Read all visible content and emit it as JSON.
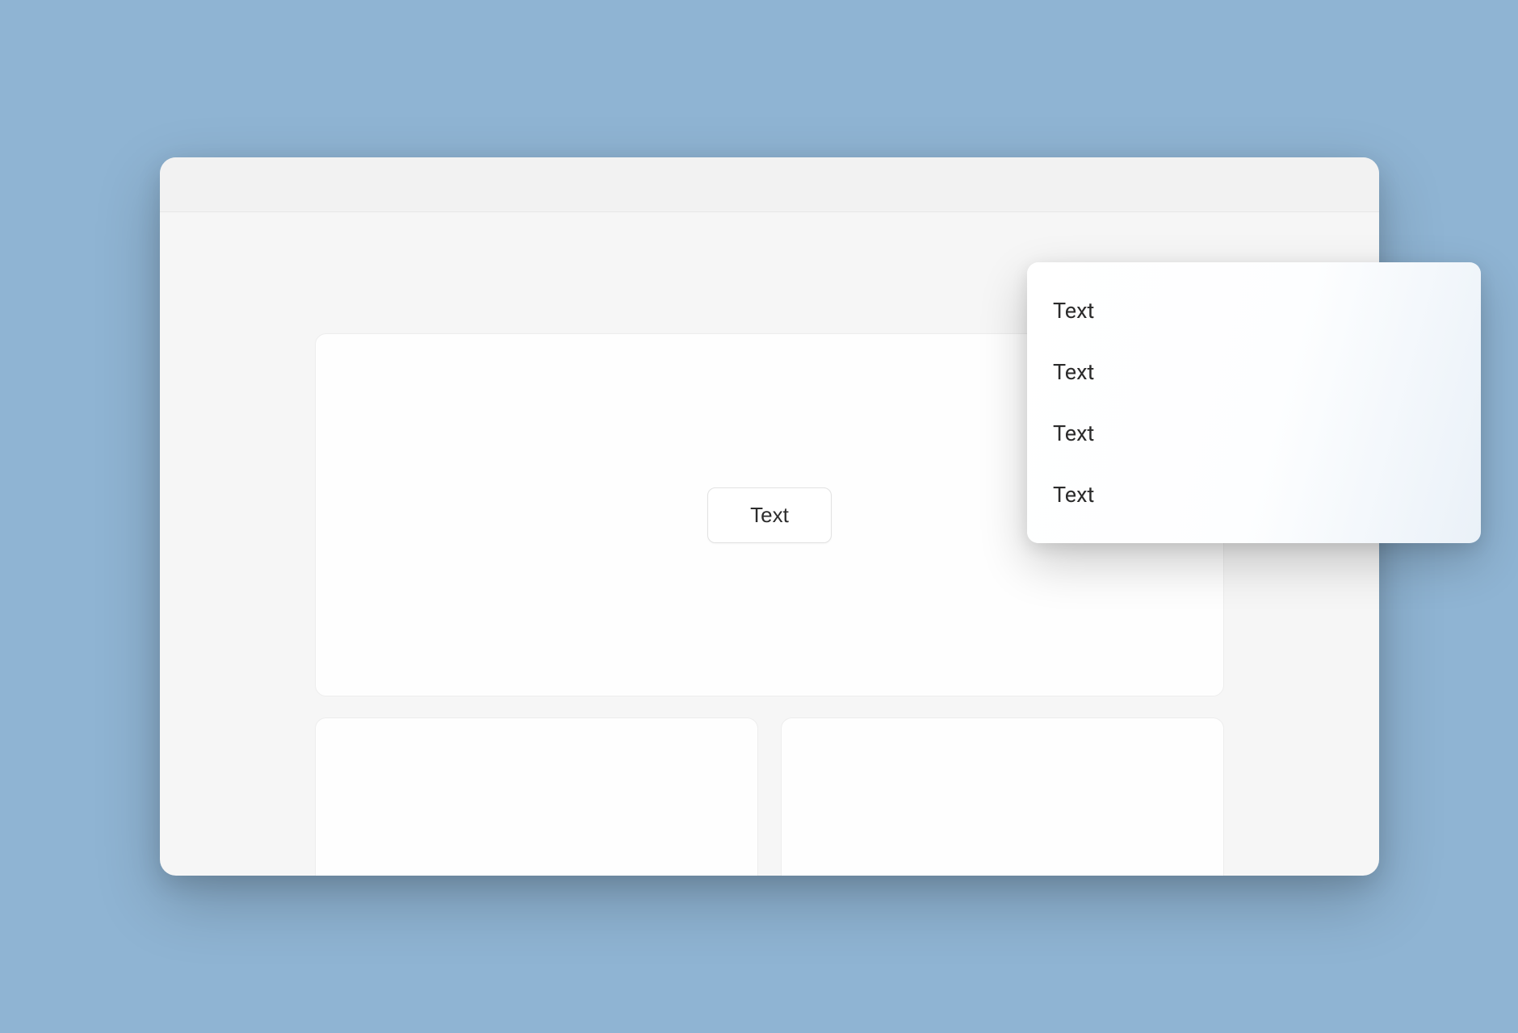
{
  "hero": {
    "button_label": "Text"
  },
  "dropdown": {
    "items": [
      {
        "label": "Text"
      },
      {
        "label": "Text"
      },
      {
        "label": "Text"
      },
      {
        "label": "Text"
      }
    ]
  }
}
